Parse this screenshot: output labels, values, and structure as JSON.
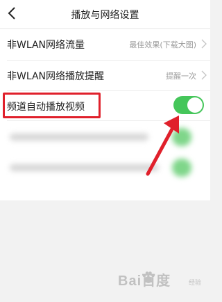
{
  "header": {
    "title": "播放与网络设置",
    "back_icon": "chevron-left-icon"
  },
  "settings": [
    {
      "label": "非WLAN网络流量",
      "value": "最佳效果(下载大图)",
      "icon": "chevron-right-icon"
    },
    {
      "label": "非WLAN网络播放提醒",
      "value": "提醒一次",
      "icon": "chevron-right-icon"
    },
    {
      "label": "频道自动播放视频",
      "toggle_on": true
    }
  ],
  "colors": {
    "toggle_on": "#45c65a",
    "highlight": "#e0202b",
    "arrow": "#e0202b"
  },
  "watermark": {
    "text": "Bai百度",
    "sub": "经验"
  }
}
